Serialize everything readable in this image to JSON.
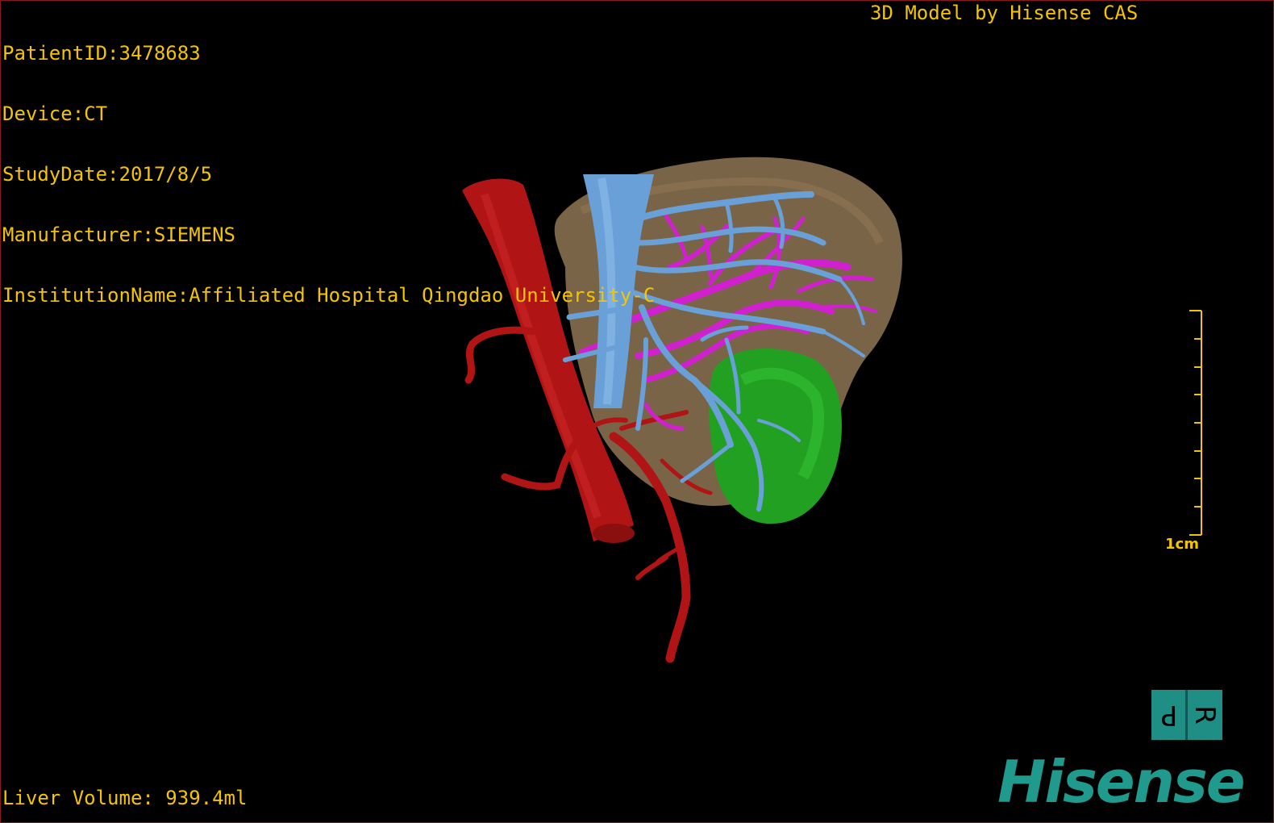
{
  "info": {
    "patient_id": "PatientID:3478683",
    "device": "Device:CT",
    "study_date": "StudyDate:2017/8/5",
    "manufacturer": "Manufacturer:SIEMENS",
    "institution": "InstitutionName:Affiliated Hospital Qingdao University-C"
  },
  "credit": "3D Model by Hisense CAS",
  "liver_volume": "Liver Volume: 939.4ml",
  "scale_bar": {
    "label": "1cm"
  },
  "orientation": {
    "left": "P",
    "right": "R"
  },
  "logo": {
    "text": "Hisense"
  },
  "colors": {
    "overlay_text": "#f5c400",
    "liver": "#7a6447",
    "aorta": "#b01414",
    "ivc_portal": "#6aa0d8",
    "hepatic_vein": "#d020d0",
    "tumor": "#22a022",
    "logo": "#1f9a8d"
  }
}
